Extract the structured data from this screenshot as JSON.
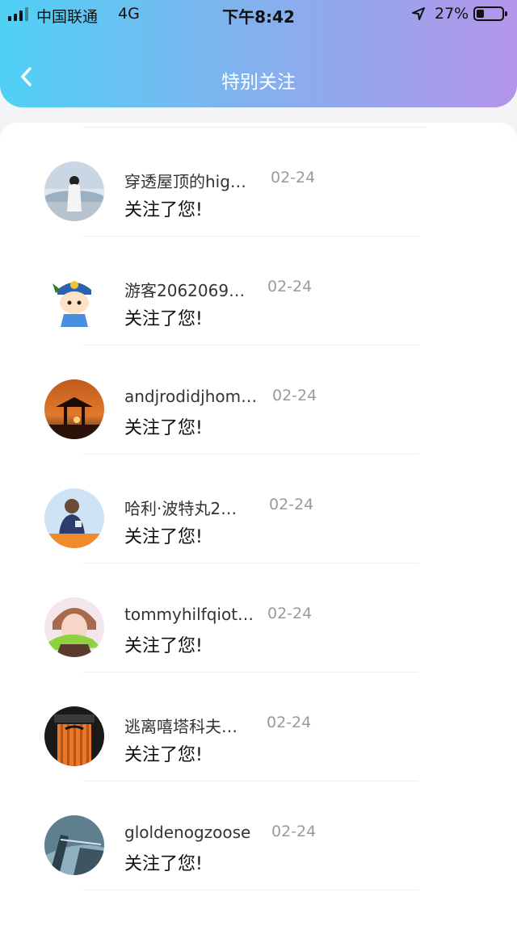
{
  "status_bar": {
    "carrier": "中国联通",
    "network": "4G",
    "time": "下午8:42",
    "battery": "27%",
    "battery_level": 0.27
  },
  "nav": {
    "title": "特别关注",
    "back_icon": "chevron-left-icon"
  },
  "notifications": [
    {
      "name": "穿透屋顶的hig…",
      "date": "02-24",
      "message": "关注了您!"
    },
    {
      "name": "游客2062069…",
      "date": "02-24",
      "message": "关注了您!"
    },
    {
      "name": "andjrodidjhom…",
      "date": "02-24",
      "message": "关注了您!"
    },
    {
      "name": "哈利·波特丸2…",
      "date": "02-24",
      "message": "关注了您!"
    },
    {
      "name": "tommyhilfqiot…",
      "date": "02-24",
      "message": "关注了您!"
    },
    {
      "name": "逃离嘻塔科夫…",
      "date": "02-24",
      "message": "关注了您!"
    },
    {
      "name": "gloldenogzoose",
      "date": "02-24",
      "message": "关注了您!"
    }
  ]
}
